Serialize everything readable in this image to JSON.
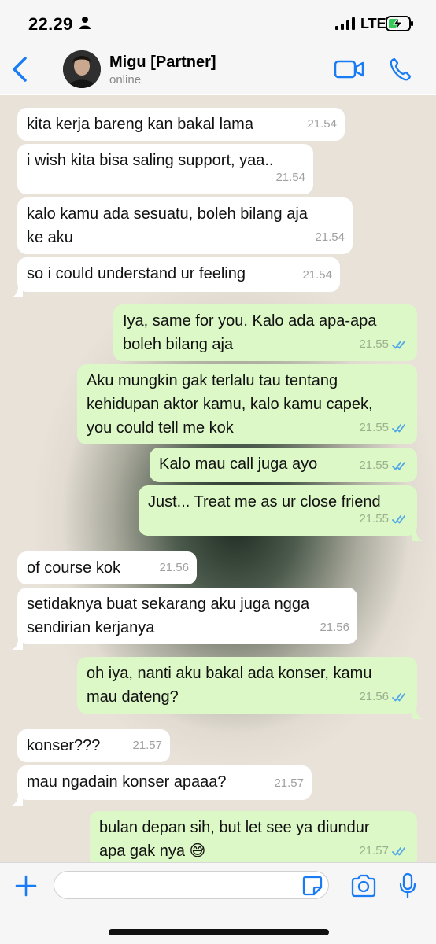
{
  "status_bar": {
    "time": "22.29",
    "network": "LTE"
  },
  "header": {
    "contact_name": "Migu [Partner]",
    "contact_status": "online",
    "icons": {
      "back": "chevron-left-icon",
      "video": "video-camera-icon",
      "call": "phone-icon"
    },
    "accent_color": "#1a7cf4"
  },
  "messages": [
    {
      "dir": "in",
      "lines": [
        "kita kerja bareng kan bakal lama"
      ],
      "time": "21.54"
    },
    {
      "dir": "in",
      "lines": [
        "i wish kita bisa saling support, yaa.."
      ],
      "time": "21.54"
    },
    {
      "dir": "in",
      "lines": [
        "kalo kamu ada sesuatu, boleh bilang aja",
        "ke aku"
      ],
      "time": "21.54"
    },
    {
      "dir": "in",
      "lines": [
        "so i could understand ur feeling"
      ],
      "time": "21.54"
    },
    {
      "dir": "out",
      "lines": [
        "Iya, same for you. Kalo ada apa-apa",
        "boleh bilang aja"
      ],
      "time": "21.55"
    },
    {
      "dir": "out",
      "lines": [
        "Aku mungkin gak terlalu tau tentang",
        "kehidupan aktor kamu, kalo kamu capek,",
        "you could tell me kok"
      ],
      "time": "21.55"
    },
    {
      "dir": "out",
      "lines": [
        "Kalo mau call juga ayo"
      ],
      "time": "21.55"
    },
    {
      "dir": "out",
      "lines": [
        "Just... Treat me as ur close friend"
      ],
      "time": "21.55"
    },
    {
      "dir": "in",
      "lines": [
        "of course kok"
      ],
      "time": "21.56"
    },
    {
      "dir": "in",
      "lines": [
        "setidaknya buat sekarang aku juga ngga",
        "sendirian kerjanya"
      ],
      "time": "21.56"
    },
    {
      "dir": "out",
      "lines": [
        "oh iya, nanti aku bakal ada konser, kamu",
        "mau dateng?"
      ],
      "time": "21.56"
    },
    {
      "dir": "in",
      "lines": [
        "konser???"
      ],
      "time": "21.57"
    },
    {
      "dir": "in",
      "lines": [
        "mau ngadain konser apaaa?"
      ],
      "time": "21.57"
    },
    {
      "dir": "out",
      "lines": [
        "bulan depan sih, but let see ya diundur",
        "apa gak nya 😅"
      ],
      "time": "21.57"
    }
  ],
  "input_bar": {
    "placeholder": "",
    "icons": [
      "plus-icon",
      "sticker-icon",
      "camera-icon",
      "microphone-icon"
    ]
  },
  "colors": {
    "incoming_bubble": "#ffffff",
    "outgoing_bubble": "#dcf8c6",
    "read_ticks": "#4fa6e8"
  }
}
